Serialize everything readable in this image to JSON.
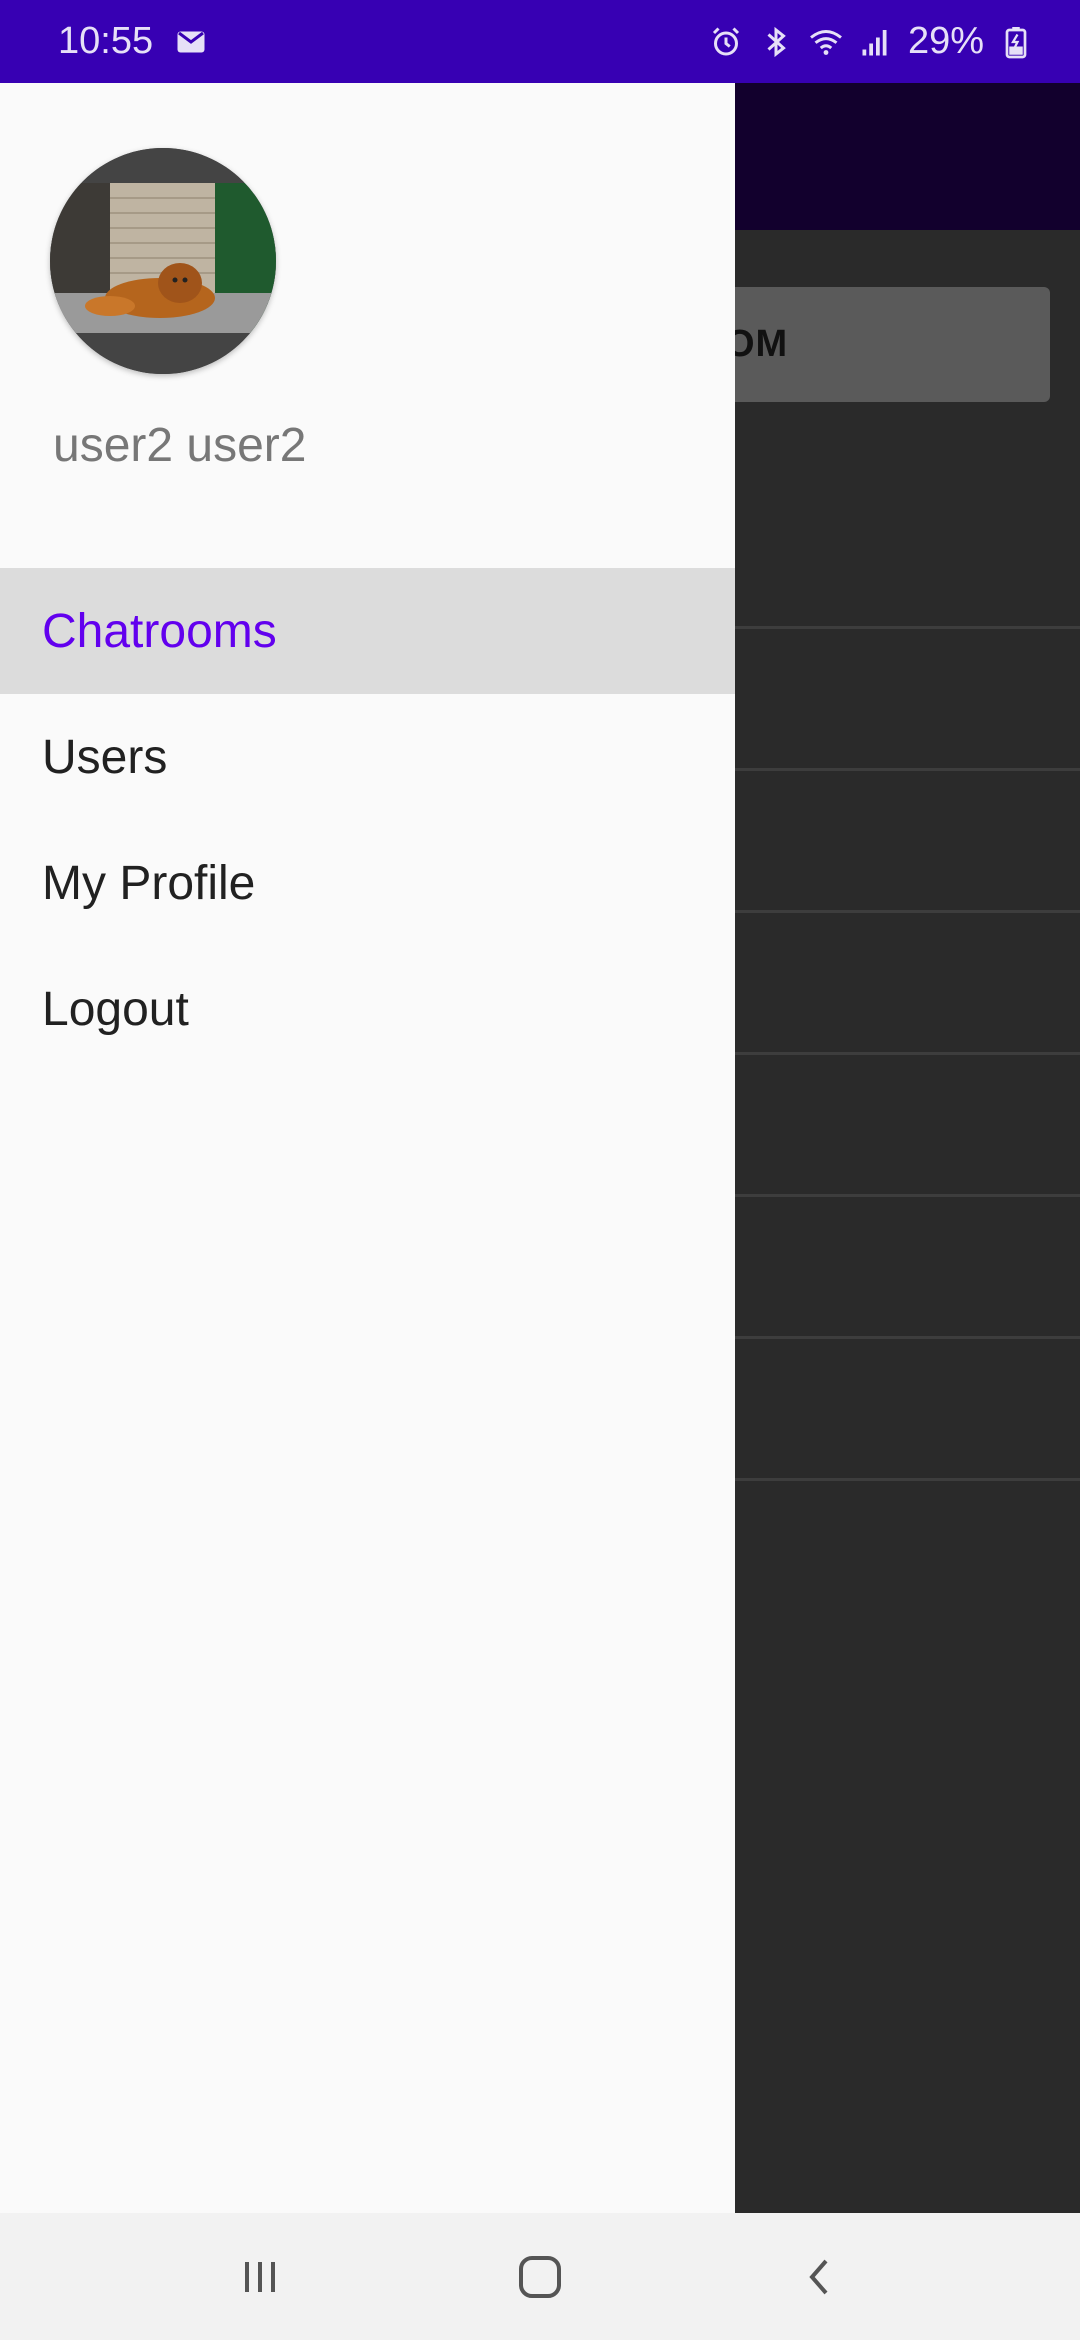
{
  "status_bar": {
    "time": "10:55",
    "battery": "29%",
    "notification_icons": [
      "gmail-icon"
    ],
    "system_icons": [
      "alarm-icon",
      "bluetooth-icon",
      "wifi-icon",
      "signal-icon",
      "battery-charging-icon"
    ]
  },
  "background_app": {
    "button_text": "OM"
  },
  "drawer": {
    "username": "user2 user2",
    "menu": [
      {
        "label": "Chatrooms",
        "selected": true
      },
      {
        "label": "Users",
        "selected": false
      },
      {
        "label": "My Profile",
        "selected": false
      },
      {
        "label": "Logout",
        "selected": false
      }
    ]
  },
  "nav_bar": {
    "buttons": [
      "recents-icon",
      "home-icon",
      "back-icon"
    ]
  },
  "colors": {
    "status_bar": "#3700b3",
    "accent": "#6200ee",
    "selected_item_bg": "#dcdcdc",
    "drawer_bg": "#fafafa",
    "scrim_bg": "#2a2a2a"
  }
}
